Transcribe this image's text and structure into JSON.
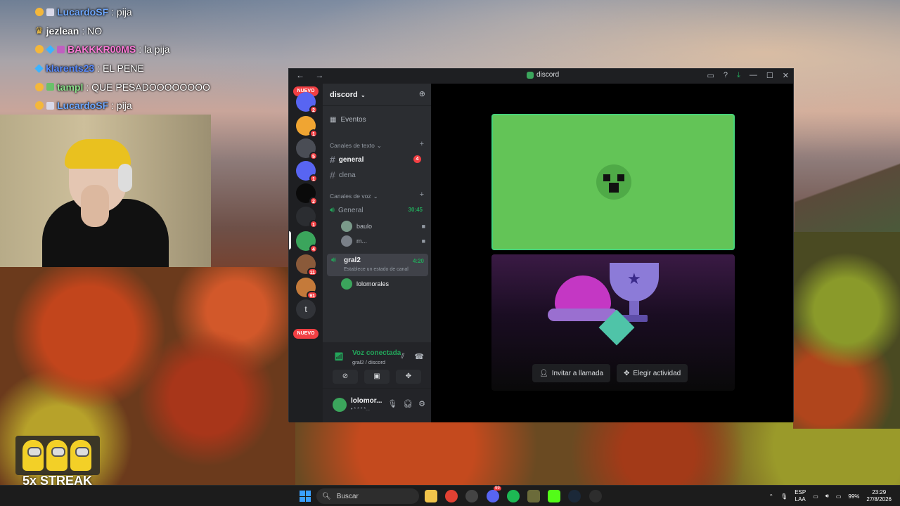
{
  "chat": [
    {
      "badges": [
        "dot",
        "sq"
      ],
      "user": "LucardoSF",
      "user_color": "#6fa8ff",
      "message": ": pija"
    },
    {
      "badges": [
        "crown"
      ],
      "user": "jezlean",
      "user_color": "#ffffff",
      "message": ": NO"
    },
    {
      "badges": [
        "dot",
        "cube",
        "sq"
      ],
      "user": "BAKKKR00MS",
      "user_color": "#ff7ad9",
      "message": ": la pija"
    },
    {
      "badges": [
        "cube"
      ],
      "user": "klarents23",
      "user_color": "#5a8cff",
      "message": ": EL PENE"
    },
    {
      "badges": [
        "dot",
        "sq"
      ],
      "user": "tampl",
      "user_color": "#8ce28c",
      "message": ": QUE PESADOOOOOOOO"
    },
    {
      "badges": [
        "dot",
        "sq"
      ],
      "user": "LucardoSF",
      "user_color": "#6fa8ff",
      "message": ": pija"
    }
  ],
  "streak": {
    "label": "5x STREAK"
  },
  "window": {
    "title": "discord",
    "nav": "← →"
  },
  "servers": {
    "nuevo_label": "NUEVO",
    "badges": [
      "2",
      "1",
      "5",
      "1",
      "2",
      "1",
      "4",
      "11",
      "91"
    ],
    "text_server": "t"
  },
  "guild": {
    "name": "discord",
    "events_label": "Eventos",
    "text_category": "Canales de texto",
    "voice_category": "Canales de voz",
    "text_channels": [
      {
        "name": "general",
        "badge": "4"
      },
      {
        "name": "clena"
      }
    ],
    "voice_channels": [
      {
        "name": "General",
        "time": "30:45",
        "users": [
          "baulo",
          "m..."
        ]
      },
      {
        "name": "gral2",
        "time": "4:20",
        "status": "Establece un estado de canal",
        "users": [
          "lolomorales"
        ]
      }
    ]
  },
  "voice_panel": {
    "title": "Voz conectada",
    "subtitle": "gral2 / discord"
  },
  "user_panel": {
    "name": "lolomor...",
    "status": "• * * * *..."
  },
  "activity": {
    "invite_label": "Invitar a llamada",
    "choose_label": "Elegir actividad"
  },
  "taskbar": {
    "search_placeholder": "Buscar",
    "lang_top": "ESP",
    "lang_bottom": "LAA",
    "battery": "99%",
    "time": "23:29",
    "date": "27/8/2026",
    "app_badge": "99"
  },
  "colors": {
    "discord_green": "#23a55a",
    "discord_red": "#f23f43",
    "blurple": "#5865f2"
  }
}
